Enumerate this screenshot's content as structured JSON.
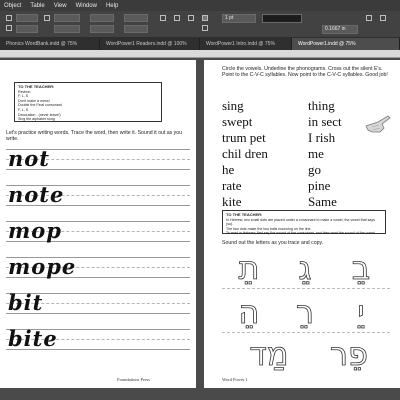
{
  "menubar": {
    "items": [
      "Object",
      "Table",
      "View",
      "Window",
      "Help"
    ]
  },
  "controlbar": {
    "font_size": "8 pt",
    "stroke_weight": "1 pt",
    "measurement": "0.1667 in"
  },
  "tabs": [
    {
      "label": "Phonics WordBank.indd @ 75%",
      "active": false
    },
    {
      "label": "WordPower1 Readers.indd @ 100%",
      "active": false
    },
    {
      "label": "WordPower1 Intro.indd @ 75%",
      "active": false
    },
    {
      "label": "WordPower1.indd @ 75%",
      "active": true
    }
  ],
  "left_page": {
    "teacher_box": {
      "title": "TO THE TEACHER:",
      "lines": [
        "Review:",
        "F, L, S",
        "Don't make a mess!",
        "Double the Final consonant",
        "F, L, S",
        "Decoration - (never leave!)",
        "Sing the alphabet song"
      ]
    },
    "instructions": "Let's practice writing words. Trace the word, then write it. Sound it out as you write.",
    "words": [
      "not",
      "note",
      "mop",
      "mope",
      "bit",
      "bite"
    ],
    "footer": "Foundations Press"
  },
  "right_page": {
    "instructions": "Circle the vowels. Underline the phonograms. Cross out the silent E's. Point to the C-V-C syllables. Now point to the C-V-C syllables. Good job!",
    "word_columns": [
      [
        "sing",
        "swept",
        "trum pet",
        "chil dren",
        "he",
        "rate",
        "kite"
      ],
      [
        "thing",
        "in sect",
        "I rish",
        "me",
        "go",
        "pine",
        "Same"
      ]
    ],
    "teacher_box": {
      "title": "TO THE TEACHER:",
      "lines": [
        "In Hebrew, two small dots are placed under a consonant to make a vowel; the vowel that says (so).",
        "The two dots make the two balls bouncing on the line.",
        "To read in Hebrew, first say the sound of the consonant, and then read the sound of the vowel.",
        "under a. Remember: we read from right to left."
      ]
    },
    "hebrew_instructions": "Sound out the letters as you trace and copy.",
    "hebrew_rows": [
      [
        "תֵ",
        "גֵ",
        "בֵ"
      ],
      [
        "הֵ",
        "רֵ",
        "יֵ"
      ],
      [
        "מַד",
        "פֵר"
      ]
    ],
    "footer": "Word Power 1"
  }
}
